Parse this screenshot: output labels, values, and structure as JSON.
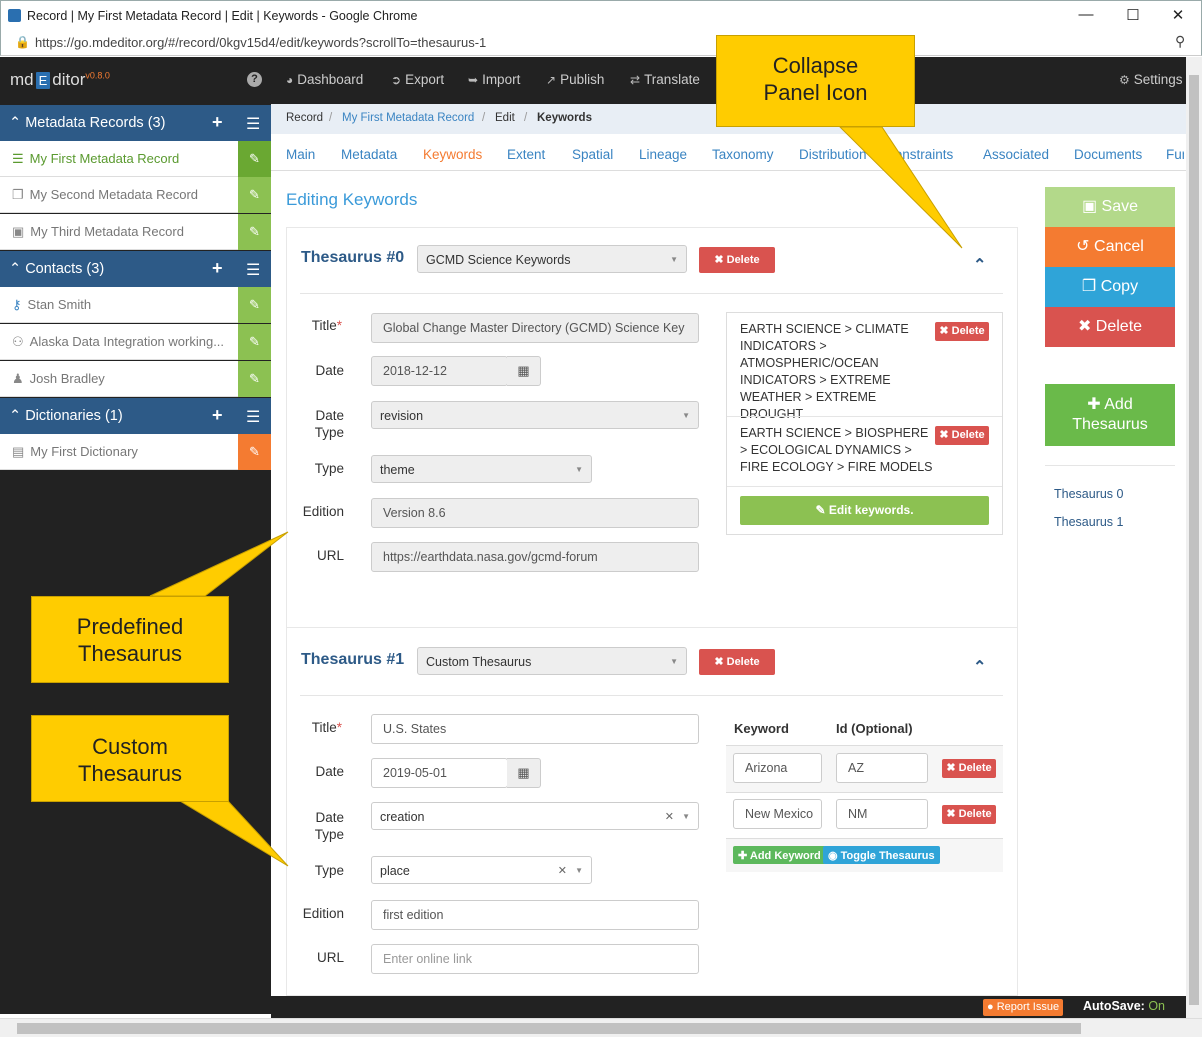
{
  "window": {
    "title": "Record | My First Metadata Record | Edit | Keywords - Google Chrome",
    "url": "https://go.mdeditor.org/#/record/0kgv15d4/edit/keywords?scrollTo=thesaurus-1"
  },
  "brand": {
    "left": "md",
    "mid": "E",
    "right": "ditor",
    "version": "v0.8.0"
  },
  "topnav": {
    "dashboard": "Dashboard",
    "export": "Export",
    "import": "Import",
    "publish": "Publish",
    "translate": "Translate",
    "settings": "Settings"
  },
  "sidebar": {
    "records_header": "Metadata Records (3)",
    "records": [
      "My First Metadata Record",
      "My Second Metadata Record",
      "My Third Metadata Record"
    ],
    "contacts_header": "Contacts (3)",
    "contacts": [
      "Stan Smith",
      "Alaska Data Integration working...",
      "Josh Bradley"
    ],
    "dictionaries_header": "Dictionaries (1)",
    "dictionaries": [
      "My First Dictionary"
    ]
  },
  "breadcrumb": [
    "Record",
    "My First Metadata Record",
    "Edit",
    "Keywords"
  ],
  "tabs": [
    "Main",
    "Metadata",
    "Keywords",
    "Extent",
    "Spatial",
    "Lineage",
    "Taxonomy",
    "Distribution",
    "Constraints",
    "Associated",
    "Documents",
    "Fun"
  ],
  "page_title": "Editing Keywords",
  "labels": {
    "title": "Title",
    "date": "Date",
    "date_type_1": "Date",
    "date_type_2": "Type",
    "type": "Type",
    "edition": "Edition",
    "url": "URL",
    "delete": "Delete",
    "edit_keywords": "Edit keywords.",
    "keyword": "Keyword",
    "id_optional": "Id (Optional)",
    "add_keyword": "Add Keyword",
    "toggle_thesaurus": "Toggle Thesaurus"
  },
  "thesaurus0": {
    "heading": "Thesaurus #0",
    "select": "GCMD Science Keywords",
    "title": "Global Change Master Directory (GCMD) Science Key",
    "date": "2018-12-12",
    "date_type": "revision",
    "type": "theme",
    "edition": "Version 8.6",
    "url": "https://earthdata.nasa.gov/gcmd-forum",
    "keywords": [
      "EARTH SCIENCE > CLIMATE INDICATORS > ATMOSPHERIC/OCEAN INDICATORS > EXTREME WEATHER > EXTREME DROUGHT",
      "EARTH SCIENCE > BIOSPHERE > ECOLOGICAL DYNAMICS > FIRE ECOLOGY > FIRE MODELS"
    ]
  },
  "thesaurus1": {
    "heading": "Thesaurus #1",
    "select": "Custom Thesaurus",
    "title": "U.S. States",
    "date": "2019-05-01",
    "date_type": "creation",
    "type": "place",
    "edition": "first edition",
    "url_placeholder": "Enter online link",
    "keywords": [
      {
        "keyword": "Arizona",
        "id": "AZ"
      },
      {
        "keyword": "New Mexico",
        "id": "NM"
      }
    ]
  },
  "actions": {
    "save": "Save",
    "cancel": "Cancel",
    "copy": "Copy",
    "delete": "Delete",
    "add_1": "Add",
    "add_2": "Thesaurus"
  },
  "side_links": [
    "Thesaurus 0",
    "Thesaurus 1"
  ],
  "footer": {
    "report": "Report Issue",
    "autosave_label": "AutoSave:",
    "autosave_value": "On"
  },
  "callouts": {
    "collapse_1": "Collapse",
    "collapse_2": "Panel Icon",
    "predefined_1": "Predefined",
    "predefined_2": "Thesaurus",
    "custom_1": "Custom",
    "custom_2": "Thesaurus"
  },
  "colors": {
    "accent": "#3a84c2",
    "active_tab": "#f47b31",
    "header_blue": "#2d5a87",
    "green": "#8cc152",
    "danger": "#d9534f",
    "callout": "#ffcc00"
  }
}
